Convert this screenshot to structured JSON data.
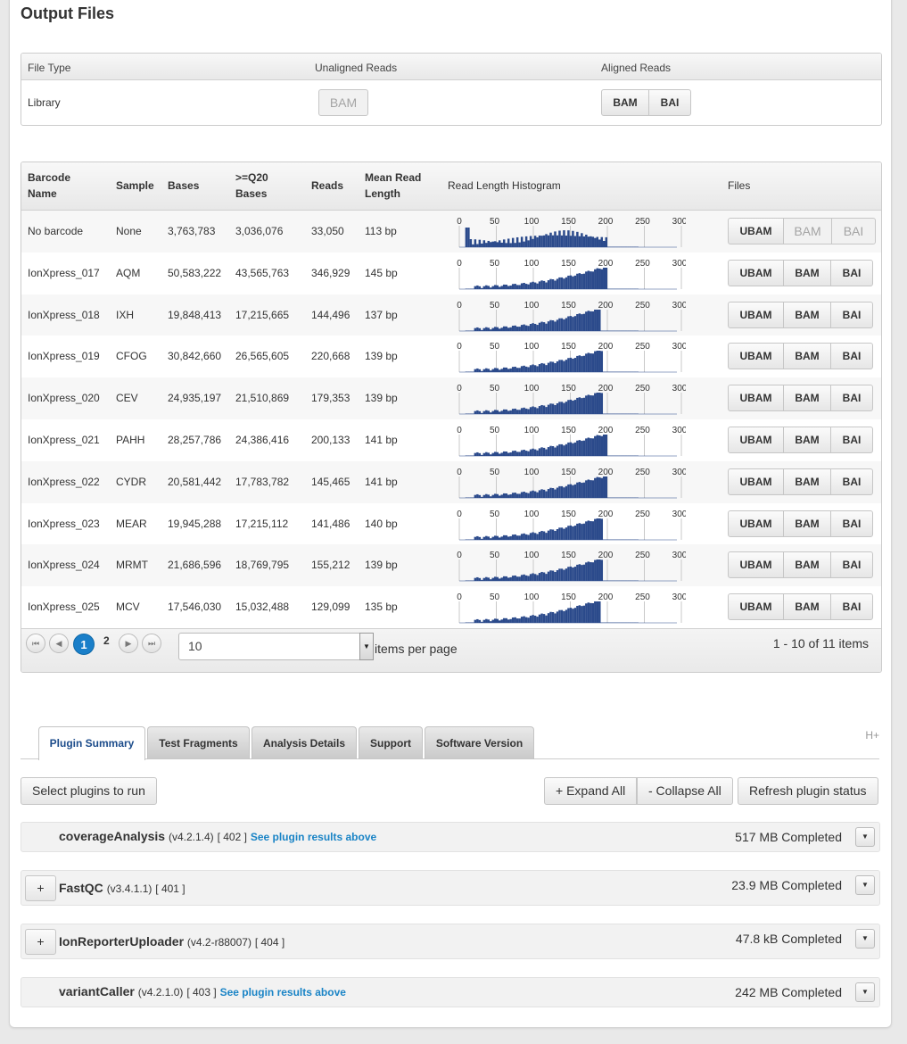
{
  "page": {
    "title": "Output Files"
  },
  "output_files": {
    "headers": [
      "File Type",
      "Unaligned Reads",
      "Aligned Reads"
    ],
    "row": {
      "type": "Library",
      "unaligned": "BAM",
      "aligned": [
        "BAM",
        "BAI"
      ]
    }
  },
  "barcodes": {
    "headers": {
      "barcode": "Barcode Name",
      "sample": "Sample",
      "bases": "Bases",
      "q20": ">=Q20 Bases",
      "reads": "Reads",
      "mean_len": "Mean Read Length",
      "histogram": "Read Length Histogram",
      "files": "Files"
    },
    "histogram_ticks": [
      "0",
      "50",
      "100",
      "150",
      "200",
      "250",
      "300"
    ],
    "file_buttons": [
      "UBAM",
      "BAM",
      "BAI"
    ],
    "rows": [
      {
        "barcode": "No barcode",
        "sample": "None",
        "bases": "3,763,783",
        "q20": "3,036,076",
        "reads": "33,050",
        "mean_len": "113 bp",
        "bam_disabled": true,
        "peak": 115
      },
      {
        "barcode": "IonXpress_017",
        "sample": "AQM",
        "bases": "50,583,222",
        "q20": "43,565,763",
        "reads": "346,929",
        "mean_len": "145 bp",
        "bam_disabled": false,
        "peak": 195
      },
      {
        "barcode": "IonXpress_018",
        "sample": "IXH",
        "bases": "19,848,413",
        "q20": "17,215,665",
        "reads": "144,496",
        "mean_len": "137 bp",
        "bam_disabled": false,
        "peak": 185
      },
      {
        "barcode": "IonXpress_019",
        "sample": "CFOG",
        "bases": "30,842,660",
        "q20": "26,565,605",
        "reads": "220,668",
        "mean_len": "139 bp",
        "bam_disabled": false,
        "peak": 190
      },
      {
        "barcode": "IonXpress_020",
        "sample": "CEV",
        "bases": "24,935,197",
        "q20": "21,510,869",
        "reads": "179,353",
        "mean_len": "139 bp",
        "bam_disabled": false,
        "peak": 190
      },
      {
        "barcode": "IonXpress_021",
        "sample": "PAHH",
        "bases": "28,257,786",
        "q20": "24,386,416",
        "reads": "200,133",
        "mean_len": "141 bp",
        "bam_disabled": false,
        "peak": 195
      },
      {
        "barcode": "IonXpress_022",
        "sample": "CYDR",
        "bases": "20,581,442",
        "q20": "17,783,782",
        "reads": "145,465",
        "mean_len": "141 bp",
        "bam_disabled": false,
        "peak": 195
      },
      {
        "barcode": "IonXpress_023",
        "sample": "MEAR",
        "bases": "19,945,288",
        "q20": "17,215,112",
        "reads": "141,486",
        "mean_len": "140 bp",
        "bam_disabled": false,
        "peak": 190
      },
      {
        "barcode": "IonXpress_024",
        "sample": "MRMT",
        "bases": "21,686,596",
        "q20": "18,769,795",
        "reads": "155,212",
        "mean_len": "139 bp",
        "bam_disabled": false,
        "peak": 190
      },
      {
        "barcode": "IonXpress_025",
        "sample": "MCV",
        "bases": "17,546,030",
        "q20": "15,032,488",
        "reads": "129,099",
        "mean_len": "135 bp",
        "bam_disabled": false,
        "peak": 185
      }
    ],
    "pager": {
      "current_page": "1",
      "next_page": "2",
      "per_page": "10",
      "per_page_label": "items per page",
      "info": "1 - 10 of 11 items"
    }
  },
  "tabs": [
    "Plugin Summary",
    "Test Fragments",
    "Analysis Details",
    "Support",
    "Software Version"
  ],
  "h_plus": "H+",
  "plugin_actions": {
    "select": "Select plugins to run",
    "expand": "+ Expand All",
    "collapse": "- Collapse All",
    "refresh": "Refresh plugin status"
  },
  "plugins": [
    {
      "name": "coverageAnalysis",
      "version": "(v4.2.1.4)",
      "id": "[ 402 ]",
      "link": "See plugin results above",
      "status": "517 MB Completed",
      "expandable": false
    },
    {
      "name": "FastQC",
      "version": "(v3.4.1.1)",
      "id": "[ 401 ]",
      "link": "",
      "status": "23.9 MB Completed",
      "expandable": true
    },
    {
      "name": "IonReporterUploader",
      "version": "(v4.2-r88007)",
      "id": "[ 404 ]",
      "link": "",
      "status": "47.8 kB Completed",
      "expandable": true
    },
    {
      "name": "variantCaller",
      "version": "(v4.2.1.0)",
      "id": "[ 403 ]",
      "link": "See plugin results above",
      "status": "242 MB Completed",
      "expandable": false
    }
  ],
  "colors": {
    "histogram_bar": "#2b4a8b",
    "page_active": "#1a7fc9",
    "link": "#1a84c6"
  }
}
